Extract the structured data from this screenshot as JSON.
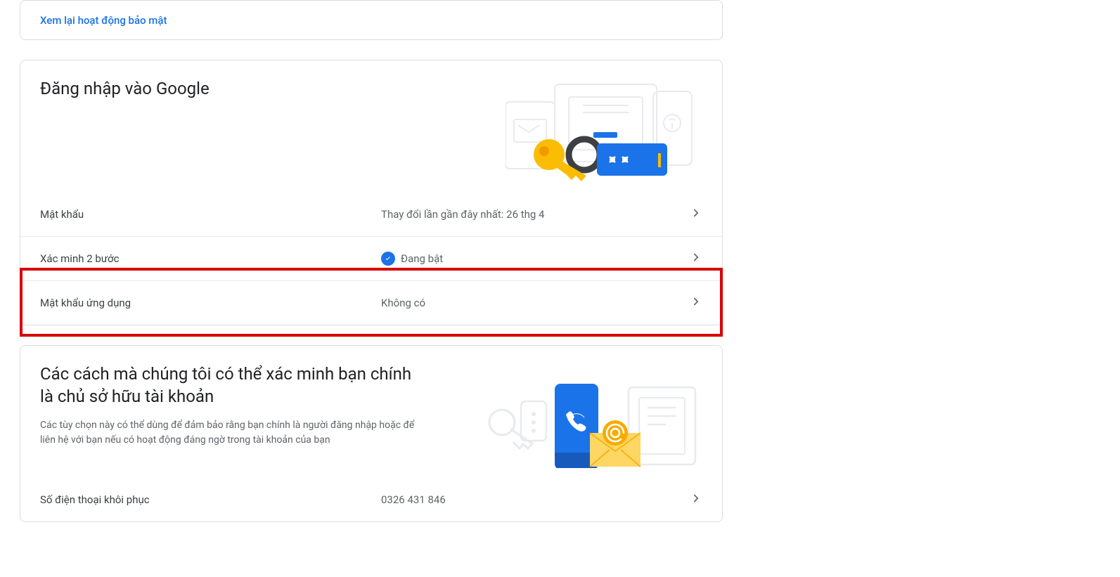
{
  "security_card": {
    "link_label": "Xem lại hoạt động bảo mật"
  },
  "signin_card": {
    "title": "Đăng nhập vào Google",
    "rows": {
      "password": {
        "label": "Mật khẩu",
        "value": "Thay đổi lần gần đây nhất: 26 thg 4"
      },
      "two_step": {
        "label": "Xác minh 2 bước",
        "value": "Đang bật"
      },
      "app_passwords": {
        "label": "Mật khẩu ứng dụng",
        "value": "Không có"
      }
    }
  },
  "recovery_card": {
    "title": "Các cách mà chúng tôi có thể xác minh bạn chính là chủ sở hữu tài khoản",
    "subtitle": "Các tùy chọn này có thể dùng để đảm bảo rằng bạn chính là người đăng nhập hoặc để liên hệ với bạn nếu có hoạt động đáng ngờ trong tài khoản của bạn",
    "rows": {
      "phone": {
        "label": "Số điện thoại khôi phục",
        "value": "0326 431 846"
      }
    }
  }
}
